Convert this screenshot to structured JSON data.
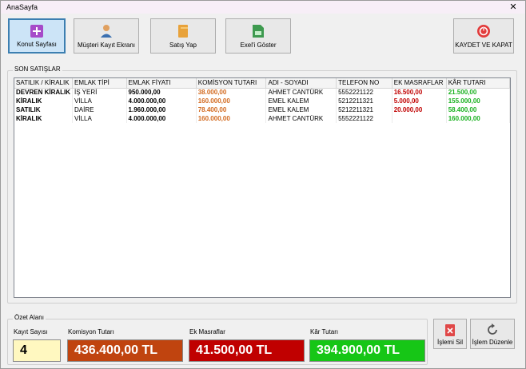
{
  "window": {
    "title": "AnaSayfa",
    "close_glyph": "✕"
  },
  "toolbar": {
    "konut_label": "Konut Sayfası",
    "musteri_label": "Müşteri Kayıt Ekranı",
    "satis_label": "Satış Yap",
    "excel_label": "Exel'i Göster",
    "kaydet_label": "KAYDET VE KAPAT"
  },
  "sales": {
    "group_label": "SON SATIŞLAR",
    "columns": [
      "SATILIK / KİRALIK",
      "EMLAK TİPİ",
      "EMLAK FİYATI",
      "KOMİSYON TUTARI",
      "ADI - SOYADI",
      "TELEFON NO",
      "EK MASRAFLAR",
      "KÂR TUTARI"
    ],
    "rows": [
      [
        "DEVREN KİRALIK",
        "İŞ YERİ",
        "950.000,00",
        "38.000,00",
        "AHMET CANTÜRK",
        "5552221122",
        "16.500,00",
        "21.500,00"
      ],
      [
        "KİRALIK",
        "VİLLA",
        "4.000.000,00",
        "160.000,00",
        "EMEL KALEM",
        "5212211321",
        "5.000,00",
        "155.000,00"
      ],
      [
        "SATILIK",
        "DAİRE",
        "1.960.000,00",
        "78.400,00",
        "EMEL KALEM",
        "5212211321",
        "20.000,00",
        "58.400,00"
      ],
      [
        "KİRALIK",
        "VİLLA",
        "4.000.000,00",
        "160.000,00",
        "AHMET CANTÜRK",
        "5552221122",
        "",
        "160.000,00"
      ]
    ]
  },
  "summary": {
    "group_label": "Özet Alanı",
    "kayit_label": "Kayıt Sayısı",
    "kayit_value": "4",
    "komisyon_label": "Komisyon Tutarı",
    "komisyon_value": "436.400,00 TL",
    "masraf_label": "Ek Masraflar",
    "masraf_value": "41.500,00 TL",
    "kar_label": "Kâr Tutarı",
    "kar_value": "394.900,00 TL",
    "sil_label": "İşlemi Sil",
    "duzenle_label": "İşlem Düzenle"
  },
  "colors": {
    "komisyon_bg": "#c0440f",
    "masraf_bg": "#c00000",
    "kar_bg": "#16c616",
    "kayit_bg": "#fff8c0"
  }
}
